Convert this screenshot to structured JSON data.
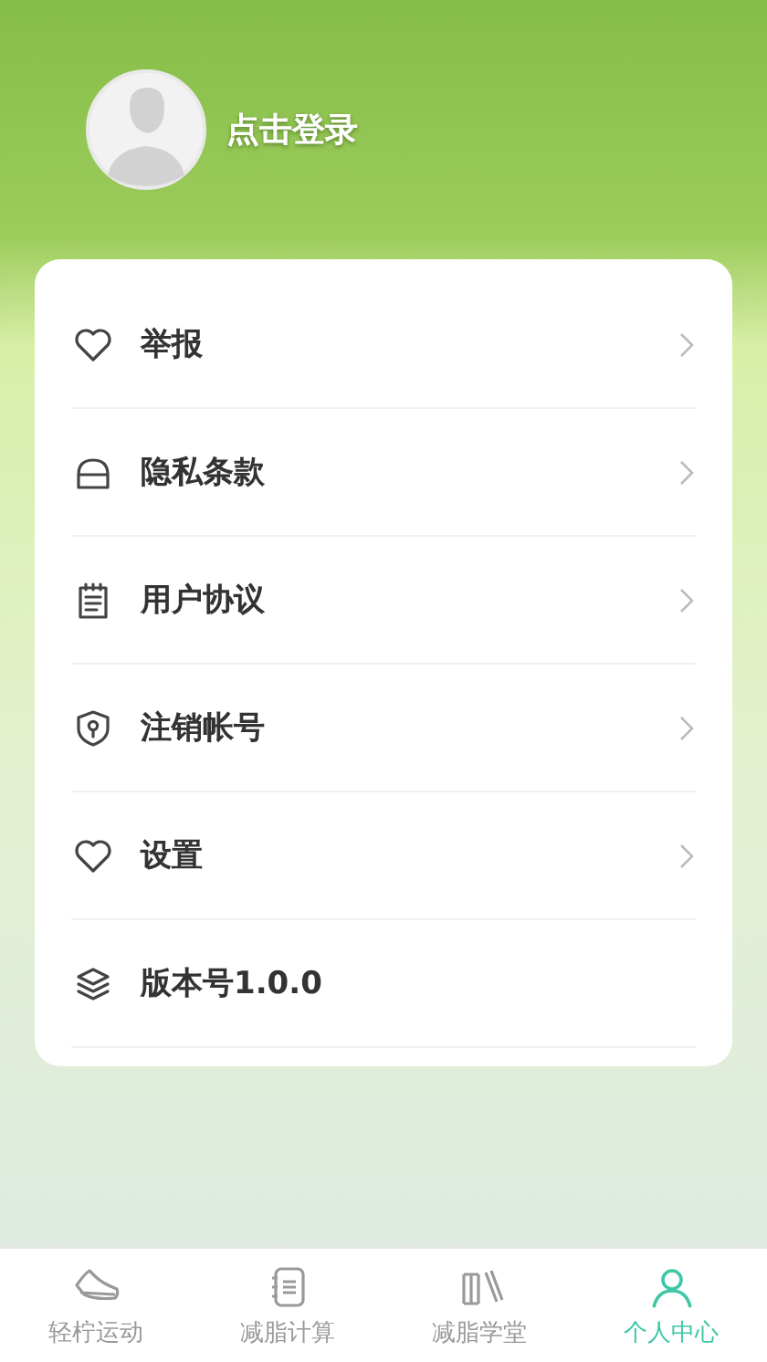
{
  "profile": {
    "login_label": "点击登录"
  },
  "menu": [
    {
      "label": "举报",
      "kind": "link"
    },
    {
      "label": "隐私条款",
      "kind": "link"
    },
    {
      "label": "用户协议",
      "kind": "link"
    },
    {
      "label": "注销帐号",
      "kind": "link"
    },
    {
      "label": "设置",
      "kind": "link"
    },
    {
      "label": "版本号1.0.0",
      "kind": "info"
    }
  ],
  "tabs": [
    {
      "label": "轻柠运动",
      "selected": false
    },
    {
      "label": "减脂计算",
      "selected": false
    },
    {
      "label": "减脂学堂",
      "selected": false
    },
    {
      "label": "个人中心",
      "selected": true
    }
  ]
}
